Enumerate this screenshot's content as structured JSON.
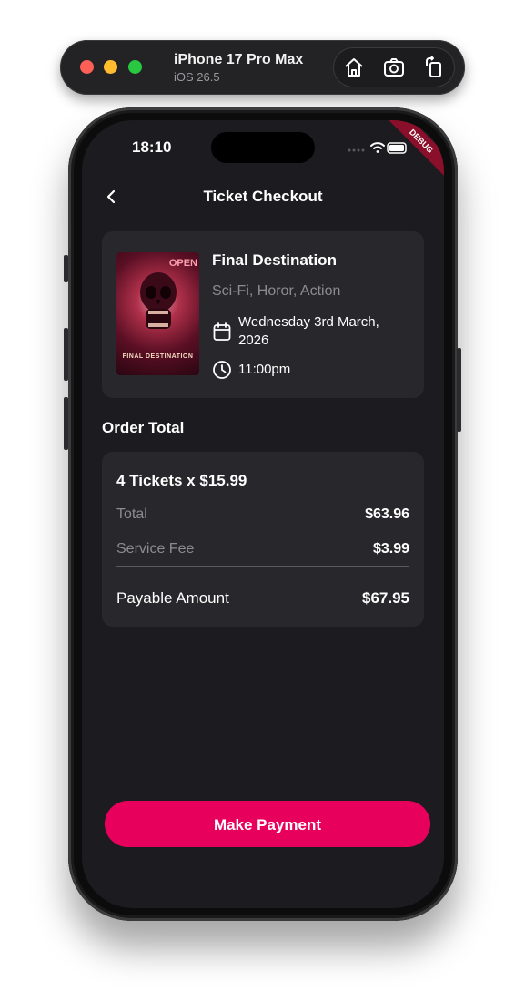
{
  "simulator": {
    "device_name": "iPhone 17 Pro Max",
    "os_version": "iOS 26.5",
    "actions": [
      "home-icon",
      "screenshot-icon",
      "rotate-icon"
    ]
  },
  "status_bar": {
    "time": "18:10",
    "debug_banner": "DEBUG"
  },
  "header": {
    "title": "Ticket Checkout"
  },
  "movie": {
    "title": "Final Destination",
    "genres": "Sci-Fi, Horor, Action",
    "date": "Wednesday 3rd March, 2026",
    "time": "11:00pm",
    "poster_text": "FINAL DESTINATION",
    "poster_open_text": "OPEN"
  },
  "order": {
    "section_title": "Order Total",
    "tickets_line": "4 Tickets x $15.99",
    "total_label": "Total",
    "total_value": "$63.96",
    "fee_label": "Service Fee",
    "fee_value": "$3.99",
    "payable_label": "Payable Amount",
    "payable_value": "$67.95"
  },
  "actions": {
    "pay_label": "Make Payment"
  },
  "colors": {
    "accent": "#e8005d",
    "background": "#1c1b1f",
    "card": "#28272b"
  }
}
